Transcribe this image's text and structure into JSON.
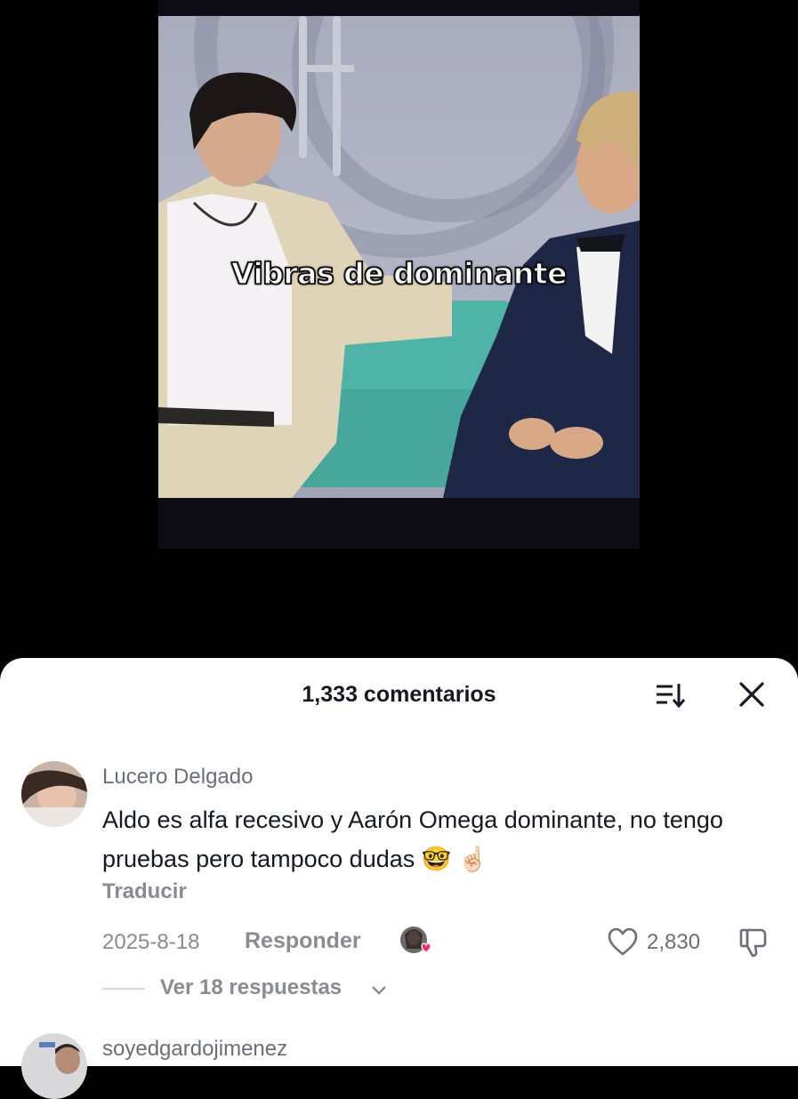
{
  "video": {
    "caption": "Vibras de dominante"
  },
  "comments_sheet": {
    "count_label": "1,333 comentarios",
    "sort_icon": "sort-icon",
    "close_icon": "close-icon"
  },
  "comments": [
    {
      "username": "Lucero Delgado",
      "text": "Aldo es alfa recesivo y Aarón Omega dominante, no tengo pruebas pero tampoco dudas 🤓 ☝🏻",
      "translate": "Traducir",
      "date": "2025-8-18",
      "reply_label": "Responder",
      "likes": "2,830",
      "view_replies": "Ver 18 respuestas"
    },
    {
      "username": "soyedgardojimenez"
    }
  ],
  "colors": {
    "sheet_bg": "#ffffff",
    "primary_text": "#161823",
    "secondary_text": "#8a8b91",
    "creator_heart": "#fe2c55"
  }
}
